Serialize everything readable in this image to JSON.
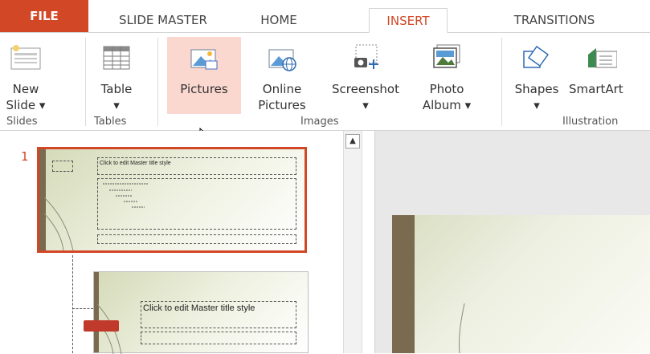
{
  "tabs": {
    "file": "FILE",
    "slide_master": "SLIDE MASTER",
    "home": "HOME",
    "insert": "INSERT",
    "transitions": "TRANSITIONS"
  },
  "ribbon": {
    "new_slide": {
      "line1": "New",
      "line2": "Slide ▾"
    },
    "table": {
      "line1": "Table",
      "line2": "▾"
    },
    "pictures": {
      "line1": "Pictures"
    },
    "online_pictures": {
      "line1": "Online",
      "line2": "Pictures"
    },
    "screenshot": {
      "line1": "Screenshot",
      "line2": "▾"
    },
    "photo_album": {
      "line1": "Photo",
      "line2": "Album ▾"
    },
    "shapes": {
      "line1": "Shapes",
      "line2": "▾"
    },
    "smartart": {
      "line1": "SmartArt"
    },
    "groups": {
      "slides": "Slides",
      "tables": "Tables",
      "images": "Images",
      "illustrations": "Illustration"
    }
  },
  "slide_pane": {
    "slide_number": "1",
    "master_title": "Click to edit Master title style",
    "layout_title": "Click to edit Master title style"
  },
  "colors": {
    "accent": "#d24726",
    "highlight": "#fad7cf"
  }
}
